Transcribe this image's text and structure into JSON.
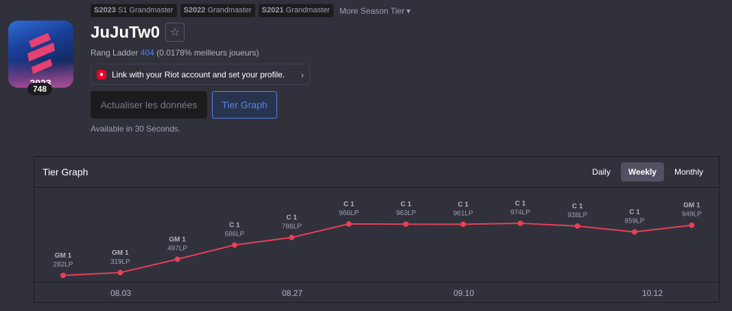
{
  "season_tags": [
    {
      "season": "S2023",
      "label": "S1 Grandmaster"
    },
    {
      "season": "S2022",
      "label": "Grandmaster"
    },
    {
      "season": "S2021",
      "label": "Grandmaster"
    }
  ],
  "more_season_tier": "More Season Tier",
  "profile": {
    "level": "748",
    "badge_year": "2023",
    "name": "JuJuTw0",
    "ladder_prefix": "Rang Ladder",
    "ladder_rank": "404",
    "ladder_suffix": "(0.0178% meilleurs joueurs)"
  },
  "riot_link": "Link with your Riot account and set your profile.",
  "buttons": {
    "update": "Actualiser les données",
    "tier_graph": "Tier Graph"
  },
  "available_text": "Available in 30 Seconds.",
  "panel": {
    "title": "Tier Graph",
    "periods": [
      "Daily",
      "Weekly",
      "Monthly"
    ],
    "active_period": "Weekly"
  },
  "colors": {
    "line": "#e84057",
    "accent": "#5383e8"
  },
  "chart_data": {
    "type": "line",
    "x_labels": [
      "08.03",
      "08.27",
      "09.10",
      "10.12"
    ],
    "points": [
      {
        "tier": "GM 1",
        "lp": "282LP",
        "value": 282
      },
      {
        "tier": "GM 1",
        "lp": "319LP",
        "value": 319
      },
      {
        "tier": "GM 1",
        "lp": "497LP",
        "value": 497
      },
      {
        "tier": "C 1",
        "lp": "686LP",
        "value": 686
      },
      {
        "tier": "C 1",
        "lp": "786LP",
        "value": 786
      },
      {
        "tier": "C 1",
        "lp": "966LP",
        "value": 966
      },
      {
        "tier": "C 1",
        "lp": "963LP",
        "value": 963
      },
      {
        "tier": "C 1",
        "lp": "961LP",
        "value": 961
      },
      {
        "tier": "C 1",
        "lp": "974LP",
        "value": 974
      },
      {
        "tier": "C 1",
        "lp": "938LP",
        "value": 938
      },
      {
        "tier": "C 1",
        "lp": "859LP",
        "value": 859
      },
      {
        "tier": "GM 1",
        "lp": "949LP",
        "value": 949
      }
    ]
  }
}
